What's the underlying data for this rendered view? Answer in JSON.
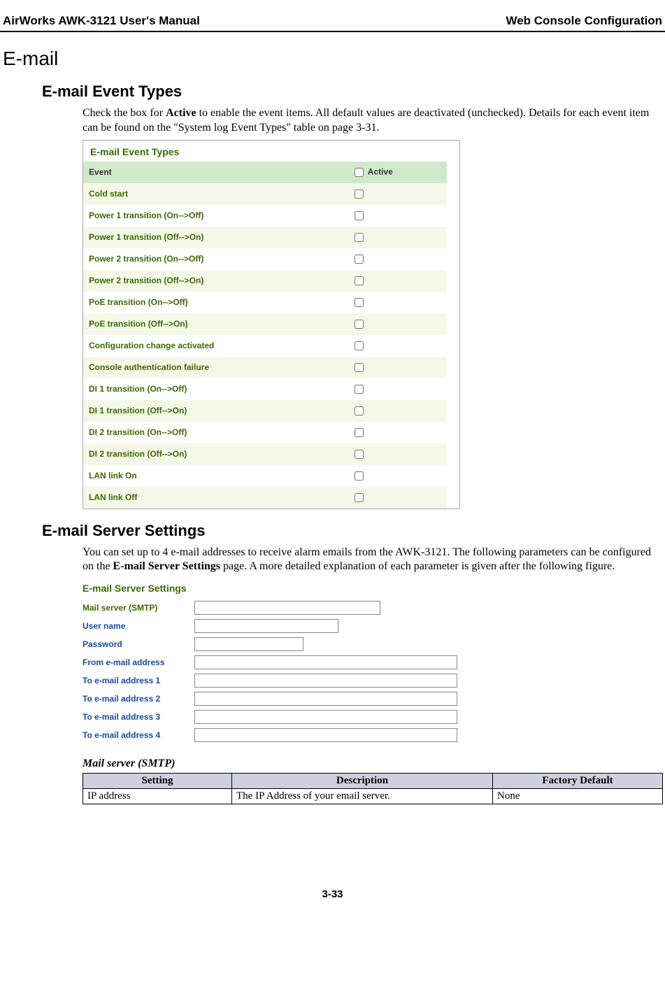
{
  "header": {
    "left": "AirWorks AWK-3121 User's Manual",
    "right": "Web Console Configuration"
  },
  "h1": "E-mail",
  "eventTypes": {
    "heading": "E-mail Event Types",
    "para_pre": "Check the box for ",
    "para_bold": "Active",
    "para_post": " to enable the event items. All default values are deactivated (unchecked). Details for each event item can be found on the \"System log Event Types\" table on page 3-31.",
    "shotTitle": "E-mail Event Types",
    "col_event": "Event",
    "col_active": "Active",
    "rows": [
      "Cold start",
      "Power 1 transition (On-->Off)",
      "Power 1 transition (Off-->On)",
      "Power 2 transition (On-->Off)",
      "Power 2 transition (Off-->On)",
      "PoE transition (On-->Off)",
      "PoE transition (Off-->On)",
      "Configuration change activated",
      "Console authentication failure",
      "DI 1 transition (On-->Off)",
      "DI 1 transition (Off-->On)",
      "DI 2 transition (On-->Off)",
      "DI 2 transition (Off-->On)",
      "LAN link On",
      "LAN link Off"
    ]
  },
  "serverSettings": {
    "heading": "E-mail Server Settings",
    "para_pre": "You can set up to 4 e-mail addresses to receive alarm emails from the AWK-3121. The following parameters can be configured on the ",
    "para_bold": "E-mail Server Settings",
    "para_post": " page. A more detailed explanation of each parameter is given after the following figure.",
    "shotTitle": "E-mail Server Settings",
    "fields": {
      "smtp": "Mail server (SMTP)",
      "user": "User name",
      "pass": "Password",
      "from": "From e-mail address",
      "to1": "To e-mail address 1",
      "to2": "To e-mail address 2",
      "to3": "To e-mail address 3",
      "to4": "To e-mail address 4"
    }
  },
  "paramTable": {
    "title": "Mail server (SMTP)",
    "headers": {
      "setting": "Setting",
      "desc": "Description",
      "def": "Factory Default"
    },
    "row": {
      "setting": "IP address",
      "desc": "The IP Address of your email server.",
      "def": "None"
    }
  },
  "footer": "3-33"
}
